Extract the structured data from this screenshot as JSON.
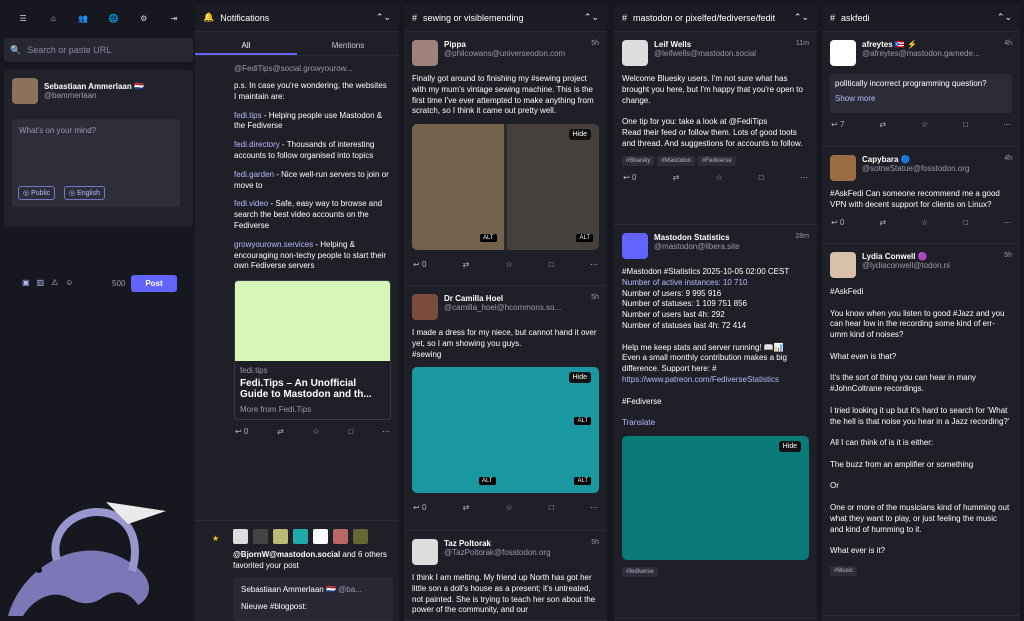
{
  "navigation": {
    "search_placeholder": "Search or paste URL",
    "icon_names": [
      "menu-icon",
      "home-icon",
      "people-icon",
      "globe-icon",
      "settings-icon",
      "logout-icon"
    ]
  },
  "composer": {
    "name": "Sebastiaan Ammerlaan 🇳🇱",
    "handle": "@bammerlaan",
    "placeholder": "What's on your mind?",
    "visibility": "Public",
    "language": "English",
    "char_count": "500",
    "post": "Post"
  },
  "notifications": {
    "title": "Notifications",
    "tabs": [
      "All",
      "Mentions"
    ],
    "handle": "@FediTips@social.growyourow...",
    "intro": "p.s. In case you're wondering, the websites I maintain are:",
    "links": [
      [
        "fedi.tips",
        "- Helping people use Mastodon & the Fediverse"
      ],
      [
        "fedi.directory",
        "- Thousands of interesting accounts to follow organised into topics"
      ],
      [
        "fedi.garden",
        "- Nice well-run servers to join or move to"
      ],
      [
        "fedi.video",
        "- Safe, easy way to browse and search the best video accounts on the Fediverse"
      ],
      [
        "growyourown.services",
        "- Helping & encouraging non-techy people to start their own Fediverse servers"
      ]
    ],
    "preview_domain": "fedi.tips",
    "preview_title": "Fedi.Tips – An Unofficial Guide to Mastodon and th...",
    "more_from": "More from",
    "more_from_site": "Fedi.Tips",
    "fav_user": "@BjornW@mastodon.social",
    "fav_text": "and 6 others favorited your post",
    "quoted_name": "Sebastiaan Ammerlaan 🇳🇱",
    "quoted_handle": "@ba...",
    "quoted_text": "Nieuwe #blogpost:"
  },
  "sewing": {
    "title": "sewing or visiblemending",
    "posts": [
      {
        "name": "Pippa",
        "handle": "@philcowans@universeodon.com",
        "time": "5h",
        "text": "Finally got around to finishing my #sewing project with my mum's vintage sewing machine. This is the first time I've ever attempted to make anything from scratch, so I think it came out pretty well.",
        "replies": "0"
      },
      {
        "name": "Dr Camilla Hoel",
        "handle": "@camilla_hoel@hcommons.so...",
        "time": "5h",
        "text": "I made a dress for my niece, but cannot hand it over yet, so I am showing you guys.\n#sewing",
        "replies": "0"
      },
      {
        "name": "Taz Poltorak",
        "handle": "@TazPoltorak@fosstodon.org",
        "time": "5h",
        "text": "I think I am melting. My friend up North has got her little son a doll's house as a present; it's untreated, not painted. She is trying to teach her son about the power of the community, and our"
      }
    ]
  },
  "mastodon": {
    "title": "mastodon or pixelfed/fediverse/fedit",
    "posts": [
      {
        "name": "Leif Wells",
        "handle": "@leifwells@mastodon.social",
        "time": "11m",
        "text": "Welcome Bluesky users. I'm not sure what has brought you here, but I'm happy that you're open to change.\n\nOne tip for you: take a look at @FediTips\nRead their feed or follow them. Lots of good toots and thread. And suggestions for accounts to follow.",
        "tags": [
          "#Bluesky",
          "#Mastodon",
          "#Fediverse"
        ],
        "replies": "0"
      },
      {
        "name": "Mastodon Statistics",
        "handle": "@mastodon@libera.site",
        "time": "28m",
        "text_a": "#Mastodon #Statistics 2025-10-05 02:00 CEST",
        "active": "Number of active instances: 10 710",
        "stats": [
          "Number of users: 9 995 916",
          "Number of statuses: 1 109 751 856",
          "Number of users last 4h: 292",
          "Number of statuses last 4h: 72 414"
        ],
        "help": "Help me keep stats and server running! 📖📊\nEven a small monthly contribution makes a big difference. Support here: #",
        "link": "https://www.patreon.com/FediverseStatistics",
        "tag": "#Fediverse",
        "translate": "Translate",
        "tags": [
          "#fediverse"
        ]
      }
    ]
  },
  "askfedi": {
    "title": "askfedi",
    "posts": [
      {
        "name": "afreytes 🇵🇷 ⚡",
        "handle": "@afreytes@mastodon.gamede...",
        "time": "4h",
        "question": "politically incorrect programming question?",
        "show_more": "Show more",
        "replies": "7"
      },
      {
        "name": "Capybara 🔵",
        "handle": "@sotneStatue@fosstodon.org",
        "time": "4h",
        "text": "#AskFedi Can someone recommend me a good VPN with decent support for clients on Linux?",
        "replies": "0"
      },
      {
        "name": "Lydia Conwell 🟣",
        "handle": "@lydiaconwell@todon.nl",
        "time": "5h",
        "text": "#AskFedi\n\nYou know when you listen to good #Jazz and you can hear low in the recording some kind of err-umm kind of noises?\n\nWhat even is that?\n\nIt's the sort of thing you can hear in many #JohnColtrane recordings.\n\nI tried looking it up but it's hard to search for 'What the hell is that noise you hear in a Jazz recording?'\n\nAll I can think of is it is either:\n\nThe buzz from an amplifier or something\n\nOr\n\nOne or more of the musicians kind of humming out what they want to play, or just feeling the music and kind of humming to it.\n\nWhat ever is it?",
        "tag": "#Music"
      }
    ]
  },
  "labels": {
    "hide": "Hide",
    "alt": "ALT"
  },
  "colors": {
    "accent": "#6364ff",
    "background": "#17171f",
    "column": "#1f1f27",
    "link": "#b9b9ff"
  }
}
